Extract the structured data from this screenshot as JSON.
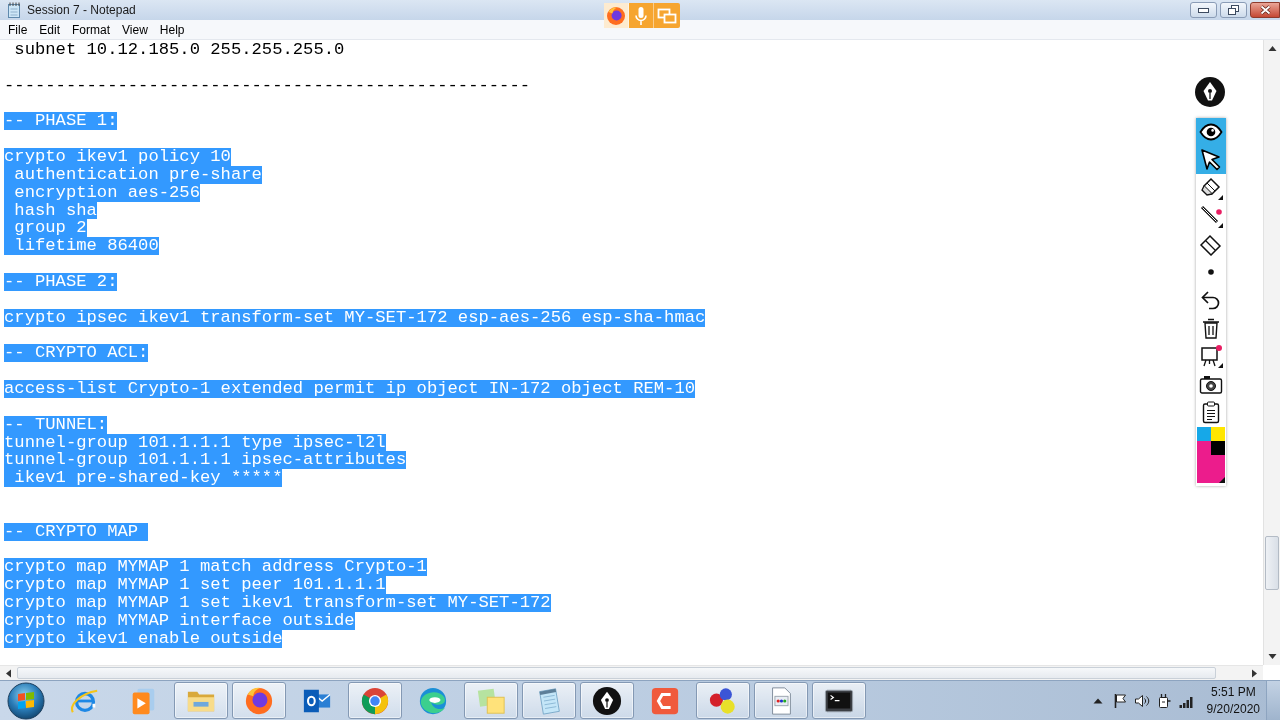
{
  "window": {
    "title": "Session 7 - Notepad"
  },
  "menu": [
    "File",
    "Edit",
    "Format",
    "View",
    "Help"
  ],
  "editor": {
    "lines": [
      {
        "kind": "text",
        "text": " subnet 10.12.185.0 255.255.255.0",
        "selected": false
      },
      {
        "kind": "blank"
      },
      {
        "kind": "text",
        "text": "---------------------------------------------------",
        "selected": false
      },
      {
        "kind": "blank"
      },
      {
        "kind": "text",
        "text": "-- PHASE 1:",
        "selected": true
      },
      {
        "kind": "blank"
      },
      {
        "kind": "text",
        "text": "crypto ikev1 policy 10",
        "selected": true
      },
      {
        "kind": "text",
        "text": " authentication pre-share",
        "selected": true
      },
      {
        "kind": "text",
        "text": " encryption aes-256",
        "selected": true
      },
      {
        "kind": "text",
        "text": " hash sha",
        "selected": true
      },
      {
        "kind": "text",
        "text": " group 2",
        "selected": true
      },
      {
        "kind": "text",
        "text": " lifetime 86400",
        "selected": true
      },
      {
        "kind": "blank"
      },
      {
        "kind": "text",
        "text": "-- PHASE 2:",
        "selected": true
      },
      {
        "kind": "blank"
      },
      {
        "kind": "text",
        "text": "crypto ipsec ikev1 transform-set MY-SET-172 esp-aes-256 esp-sha-hmac",
        "selected": true
      },
      {
        "kind": "blank"
      },
      {
        "kind": "text",
        "text": "-- CRYPTO ACL:",
        "selected": true
      },
      {
        "kind": "blank"
      },
      {
        "kind": "text",
        "text": "access-list Crypto-1 extended permit ip object IN-172 object REM-10",
        "selected": true
      },
      {
        "kind": "blank"
      },
      {
        "kind": "text",
        "text": "-- TUNNEL:",
        "selected": true
      },
      {
        "kind": "text",
        "text": "tunnel-group 101.1.1.1 type ipsec-l2l",
        "selected": true
      },
      {
        "kind": "text",
        "text": "tunnel-group 101.1.1.1 ipsec-attributes",
        "selected": true
      },
      {
        "kind": "text",
        "text": " ikev1 pre-shared-key *****",
        "selected": true
      },
      {
        "kind": "blank"
      },
      {
        "kind": "blank"
      },
      {
        "kind": "text",
        "text": "-- CRYPTO MAP ",
        "selected": true
      },
      {
        "kind": "blank"
      },
      {
        "kind": "text",
        "text": "crypto map MYMAP 1 match address Crypto-1",
        "selected": true
      },
      {
        "kind": "text",
        "text": "crypto map MYMAP 1 set peer 101.1.1.1",
        "selected": true
      },
      {
        "kind": "text",
        "text": "crypto map MYMAP 1 set ikev1 transform-set MY-SET-172",
        "selected": true
      },
      {
        "kind": "text",
        "text": "crypto map MYMAP interface outside",
        "selected": true
      },
      {
        "kind": "text",
        "text": "crypto ikev1 enable outside",
        "selected": true
      }
    ]
  },
  "sharing_indicator": {
    "items": [
      {
        "kind": "browser"
      },
      {
        "kind": "microphone"
      },
      {
        "kind": "screen"
      }
    ]
  },
  "annotation_toolbar": {
    "tools": [
      {
        "kind": "eye",
        "selected": true
      },
      {
        "kind": "pointer",
        "selected": true
      },
      {
        "kind": "highlighter",
        "selected": false
      },
      {
        "kind": "pen",
        "selected": false
      },
      {
        "kind": "eraser",
        "selected": false
      },
      {
        "kind": "dot",
        "selected": false
      },
      {
        "kind": "undo",
        "selected": false
      },
      {
        "kind": "trash",
        "selected": false
      },
      {
        "kind": "easel",
        "selected": false
      },
      {
        "kind": "camera",
        "selected": false
      },
      {
        "kind": "clipboard",
        "selected": false
      },
      {
        "kind": "palette",
        "selected": false
      }
    ]
  },
  "taskbar": {
    "apps": [
      {
        "kind": "ring",
        "running": false
      },
      {
        "kind": "play",
        "running": false
      },
      {
        "kind": "folder",
        "running": true
      },
      {
        "kind": "fox",
        "running": true
      },
      {
        "kind": "mail",
        "running": false
      },
      {
        "kind": "wheel",
        "running": true
      },
      {
        "kind": "wave",
        "running": false
      },
      {
        "kind": "notes",
        "running": true
      },
      {
        "kind": "notepad",
        "running": true
      },
      {
        "kind": "nib",
        "running": true
      },
      {
        "kind": "tile",
        "running": false
      },
      {
        "kind": "spheres",
        "running": true
      },
      {
        "kind": "document",
        "running": true
      },
      {
        "kind": "terminal",
        "running": true
      }
    ]
  },
  "tray": {
    "icons": [
      {
        "kind": "arrow"
      },
      {
        "kind": "flag"
      },
      {
        "kind": "speaker"
      },
      {
        "kind": "power"
      },
      {
        "kind": "signal"
      }
    ],
    "time": "5:51 PM",
    "date": "9/20/2020"
  }
}
